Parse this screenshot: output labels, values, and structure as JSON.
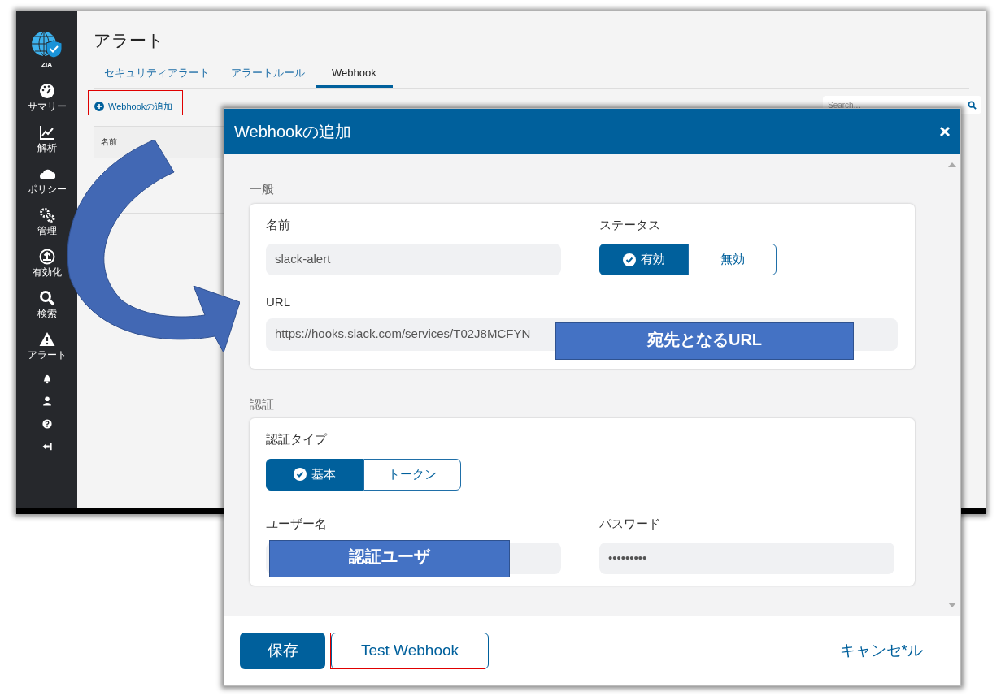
{
  "app": {
    "logo_label": "ZIA",
    "nav": [
      {
        "kind": "gauge",
        "label": "サマリー"
      },
      {
        "kind": "chart",
        "label": "解析"
      },
      {
        "kind": "cloud",
        "label": "ポリシー"
      },
      {
        "kind": "gears",
        "label": "管理"
      },
      {
        "kind": "upload",
        "label": "有効化"
      },
      {
        "kind": "search",
        "label": "検索"
      },
      {
        "kind": "warning",
        "label": "アラート"
      }
    ],
    "nav_bottom": [
      {
        "kind": "bell"
      },
      {
        "kind": "user"
      },
      {
        "kind": "help"
      },
      {
        "kind": "collapse"
      }
    ],
    "page_title": "アラート",
    "tabs": [
      {
        "label": "セキュリティアラート",
        "selected": false
      },
      {
        "label": "アラートルール",
        "selected": false
      },
      {
        "label": "Webhook",
        "selected": true
      }
    ],
    "add_button": "Webhookの追加",
    "search": {
      "placeholder": "Search..."
    },
    "table": {
      "columns": [
        "名前"
      ]
    }
  },
  "dialog": {
    "title": "Webhookの追加",
    "general": {
      "heading": "一般",
      "name_label": "名前",
      "name_value": "slack-alert",
      "status_label": "ステータス",
      "status_options": [
        {
          "label": "有効",
          "selected": true
        },
        {
          "label": "無効",
          "selected": false
        }
      ],
      "url_label": "URL",
      "url_value": "https://hooks.slack.com/services/T02J8MCFYN"
    },
    "auth": {
      "heading": "認証",
      "type_label": "認証タイプ",
      "type_options": [
        {
          "label": "基本",
          "selected": true
        },
        {
          "label": "トークン",
          "selected": false
        }
      ],
      "user_label": "ユーザー名",
      "password_label": "パスワード",
      "password_value": "•••••••••"
    },
    "buttons": {
      "save": "保存",
      "test": "Test Webhook",
      "cancel": "キャンセ*ル"
    }
  },
  "annotations": [
    {
      "text": "宛先となるURL"
    },
    {
      "text": "認証ユーザ"
    }
  ]
}
